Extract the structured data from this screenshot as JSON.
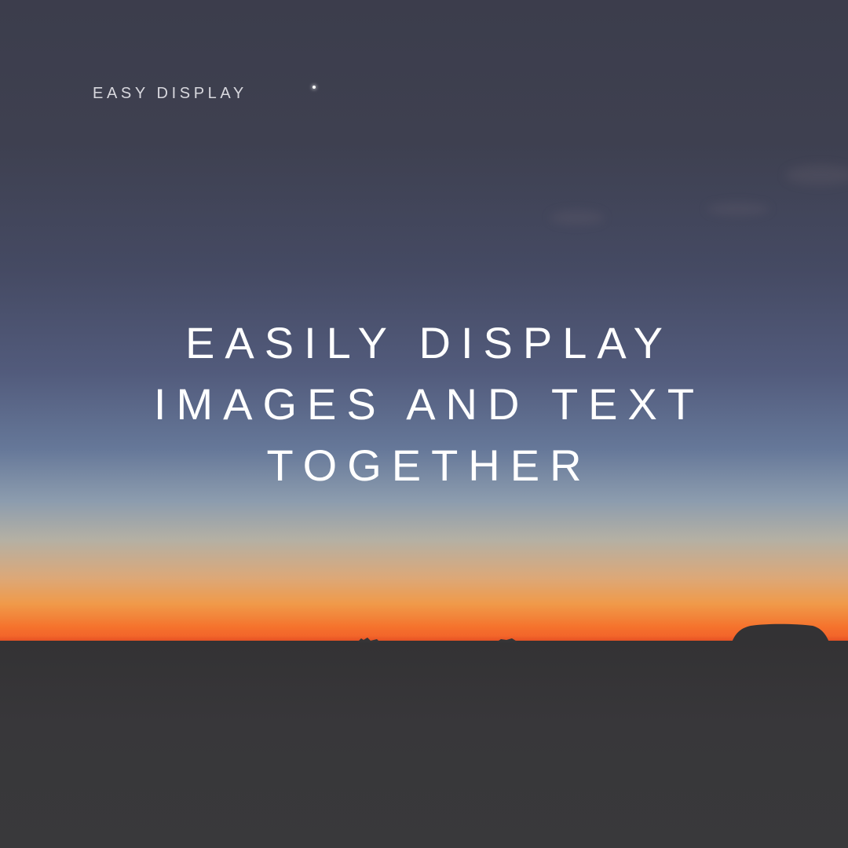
{
  "brand": {
    "label": "EASY DISPLAY"
  },
  "headline": {
    "lines": [
      "EASILY DISPLAY",
      "IMAGES AND TEXT",
      "TOGETHER"
    ]
  },
  "colors": {
    "sky_top": "#3c3d4c",
    "sky_mid": "#525b7c",
    "horizon_orange": "#f4752e",
    "ground": "#38373a",
    "text": "#ffffff"
  },
  "icons": {
    "star": "star-dot",
    "landform": "rock-silhouette"
  }
}
